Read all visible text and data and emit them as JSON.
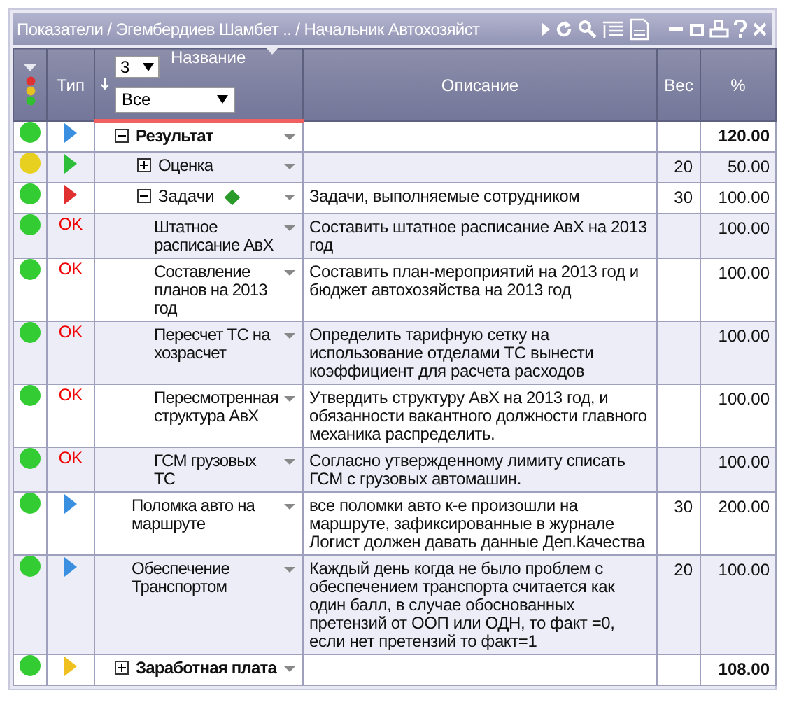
{
  "window": {
    "title": "Показатели / Эгембердиев Шамбет .. / Начальник Автохозяйст"
  },
  "header": {
    "type": "Тип",
    "level_select": "3",
    "name": "Название",
    "filter_select": "Все",
    "description": "Описание",
    "weight": "Вес",
    "percent": "%"
  },
  "rows": [
    {
      "color": "#33cc33",
      "type": {
        "kind": "arrow",
        "color": "#3a8fe0"
      },
      "name": "Результат",
      "expanded": true,
      "percent": "120.00",
      "children": [
        {
          "color": "#e8d020",
          "type": {
            "kind": "arrow",
            "color": "#2dbf3a"
          },
          "name": "Оценка",
          "expanded": false,
          "weight": "20",
          "percent": "50.00"
        },
        {
          "color": "#33cc33",
          "type": {
            "kind": "arrow",
            "color": "#e03030"
          },
          "name": "Задачи",
          "expanded": true,
          "flag": true,
          "description": "Задачи, выполняемые сотрудником",
          "weight": "30",
          "percent": "100.00",
          "children": [
            {
              "color": "#33cc33",
              "type": {
                "kind": "text",
                "label": "OK"
              },
              "name": "Штатное расписание АвХ",
              "description": "Составить штатное расписание АвХ на 2013 год",
              "percent": "100.00"
            },
            {
              "color": "#33cc33",
              "type": {
                "kind": "text",
                "label": "OK"
              },
              "name": "Составление планов на 2013 год",
              "description": "Составить план-мероприятий на 2013 год и бюджет автохозяйства на 2013 год",
              "percent": "100.00"
            },
            {
              "color": "#33cc33",
              "type": {
                "kind": "text",
                "label": "OK"
              },
              "name": "Пересчет ТС на хозрасчет",
              "description": "Определить тарифную сетку на использование отделами ТС вынести коэффициент для расчета расходов",
              "percent": "100.00"
            },
            {
              "color": "#33cc33",
              "type": {
                "kind": "text",
                "label": "OK"
              },
              "name": "Пересмотренная структура АвХ",
              "description": "Утвердить структуру АвХ на 2013 год, и обязанности вакантного должности главного механика распределить.",
              "percent": "100.00"
            },
            {
              "color": "#33cc33",
              "type": {
                "kind": "text",
                "label": "OK"
              },
              "name": "ГСМ грузовых ТС",
              "description": "Согласно утвержденному лимиту списать ГСМ с грузовых автомашин.",
              "percent": "100.00"
            }
          ]
        },
        {
          "color": "#33cc33",
          "type": {
            "kind": "arrow",
            "color": "#3a8fe0"
          },
          "name": "Поломка авто на маршруте",
          "description": "все поломки авто к-е произошли на маршруте, зафиксированные в журнале Логист должен давать данные Деп.Качества",
          "weight": "30",
          "percent": "200.00"
        },
        {
          "color": "#33cc33",
          "type": {
            "kind": "arrow",
            "color": "#3a8fe0"
          },
          "name": "Обеспечение Транспортом",
          "description": "Каждый день когда не было проблем с обеспечением транспорта считается как один балл, в случае обоснованных претензий от ООП или ОДН, то факт =0, если нет претензий то факт=1",
          "weight": "20",
          "percent": "100.00"
        }
      ]
    },
    {
      "color": "#33cc33",
      "type": {
        "kind": "arrow",
        "color": "#f0c020"
      },
      "name": "Заработная плата",
      "expanded": false,
      "percent": "108.00"
    }
  ]
}
